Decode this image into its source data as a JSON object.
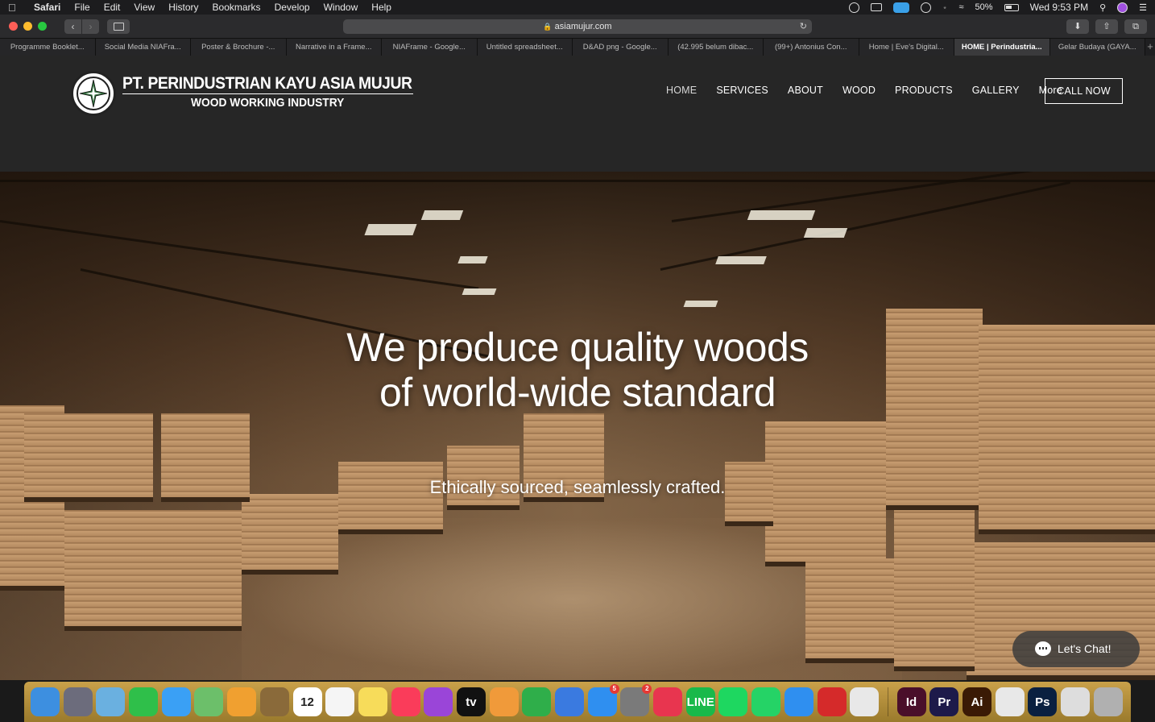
{
  "menubar": {
    "app": "Safari",
    "items": [
      "File",
      "Edit",
      "View",
      "History",
      "Bookmarks",
      "Develop",
      "Window",
      "Help"
    ],
    "battery": "50%",
    "clock": "Wed 9:53 PM"
  },
  "browser": {
    "url": "asiamujur.com",
    "tabs": [
      "Programme Booklet...",
      "Social Media NIAFra...",
      "Poster & Brochure -...",
      "Narrative in a Frame...",
      "NIAFrame - Google...",
      "Untitled spreadsheet...",
      "D&AD png - Google...",
      "(42.995 belum dibac...",
      "(99+) Antonius Con...",
      "Home | Eve's Digital...",
      "HOME | Perindustria...",
      "Gelar Budaya (GAYA..."
    ],
    "active_tab": 10
  },
  "site": {
    "company_name": "PT. PERINDUSTRIAN KAYU ASIA MUJUR",
    "company_sub": "WOOD WORKING INDUSTRY",
    "nav": [
      "HOME",
      "SERVICES",
      "ABOUT",
      "WOOD",
      "PRODUCTS",
      "GALLERY",
      "More"
    ],
    "call_label": "CALL NOW",
    "hero_title_1": "We produce quality woods",
    "hero_title_2": "of world-wide standard",
    "hero_sub": "Ethically sourced, seamlessly crafted.",
    "chat_label": "Let's Chat!",
    "logo_color": "#2e6e3a"
  },
  "dock": {
    "apps": [
      {
        "name": "finder-icon",
        "label": "",
        "color": "#3d8fe0"
      },
      {
        "name": "launchpad-icon",
        "label": "",
        "color": "#6c6c7c"
      },
      {
        "name": "preview-icon",
        "label": "",
        "color": "#6ab0e0"
      },
      {
        "name": "facetime-icon",
        "label": "",
        "color": "#2fbf4a"
      },
      {
        "name": "messages-icon",
        "label": "",
        "color": "#3aa0f5"
      },
      {
        "name": "maps-icon",
        "label": "",
        "color": "#6cbf6a"
      },
      {
        "name": "photos-icon",
        "label": "",
        "color": "#f0a030"
      },
      {
        "name": "notebook-icon",
        "label": "",
        "color": "#8a6a3a"
      },
      {
        "name": "calendar-icon",
        "label": "12",
        "color": "#ffffff",
        "dark": true
      },
      {
        "name": "reminders-icon",
        "label": "",
        "color": "#f5f5f5"
      },
      {
        "name": "notes-icon",
        "label": "",
        "color": "#f7dc5a"
      },
      {
        "name": "music-icon",
        "label": "",
        "color": "#fa3c5a"
      },
      {
        "name": "podcasts-icon",
        "label": "",
        "color": "#9a45d8"
      },
      {
        "name": "appletv-icon",
        "label": "tv",
        "color": "#111111"
      },
      {
        "name": "pages-icon",
        "label": "",
        "color": "#f09a3a"
      },
      {
        "name": "numbers-icon",
        "label": "",
        "color": "#2fae4a"
      },
      {
        "name": "keynote-icon",
        "label": "",
        "color": "#3a7ae0"
      },
      {
        "name": "appstore-icon",
        "label": "",
        "color": "#2f8ff0",
        "badge": "5"
      },
      {
        "name": "system-preferences-icon",
        "label": "",
        "color": "#7a7a7a",
        "badge": "2"
      },
      {
        "name": "creative-cloud-icon",
        "label": "",
        "color": "#e8354f"
      },
      {
        "name": "line-icon",
        "label": "LINE",
        "color": "#19b94a"
      },
      {
        "name": "spotify-icon",
        "label": "",
        "color": "#1ed760"
      },
      {
        "name": "whatsapp-icon",
        "label": "",
        "color": "#25d366"
      },
      {
        "name": "safari-icon",
        "label": "",
        "color": "#2f8ff0"
      },
      {
        "name": "acrobat-icon",
        "label": "",
        "color": "#d52a2a"
      },
      {
        "name": "textedit-icon",
        "label": "",
        "color": "#e8e8e8"
      },
      {
        "name": "indesign-icon",
        "label": "Id",
        "color": "#4a0f2a"
      },
      {
        "name": "premiere-icon",
        "label": "Pr",
        "color": "#1d1a4a"
      },
      {
        "name": "illustrator-icon",
        "label": "Ai",
        "color": "#3a1a05"
      },
      {
        "name": "chrome-icon",
        "label": "",
        "color": "#e8e8e8"
      },
      {
        "name": "photoshop-icon",
        "label": "Ps",
        "color": "#0a2040"
      },
      {
        "name": "documents-icon",
        "label": "",
        "color": "#dddddd"
      },
      {
        "name": "trash-icon",
        "label": "",
        "color": "#b0b0b0"
      }
    ]
  }
}
